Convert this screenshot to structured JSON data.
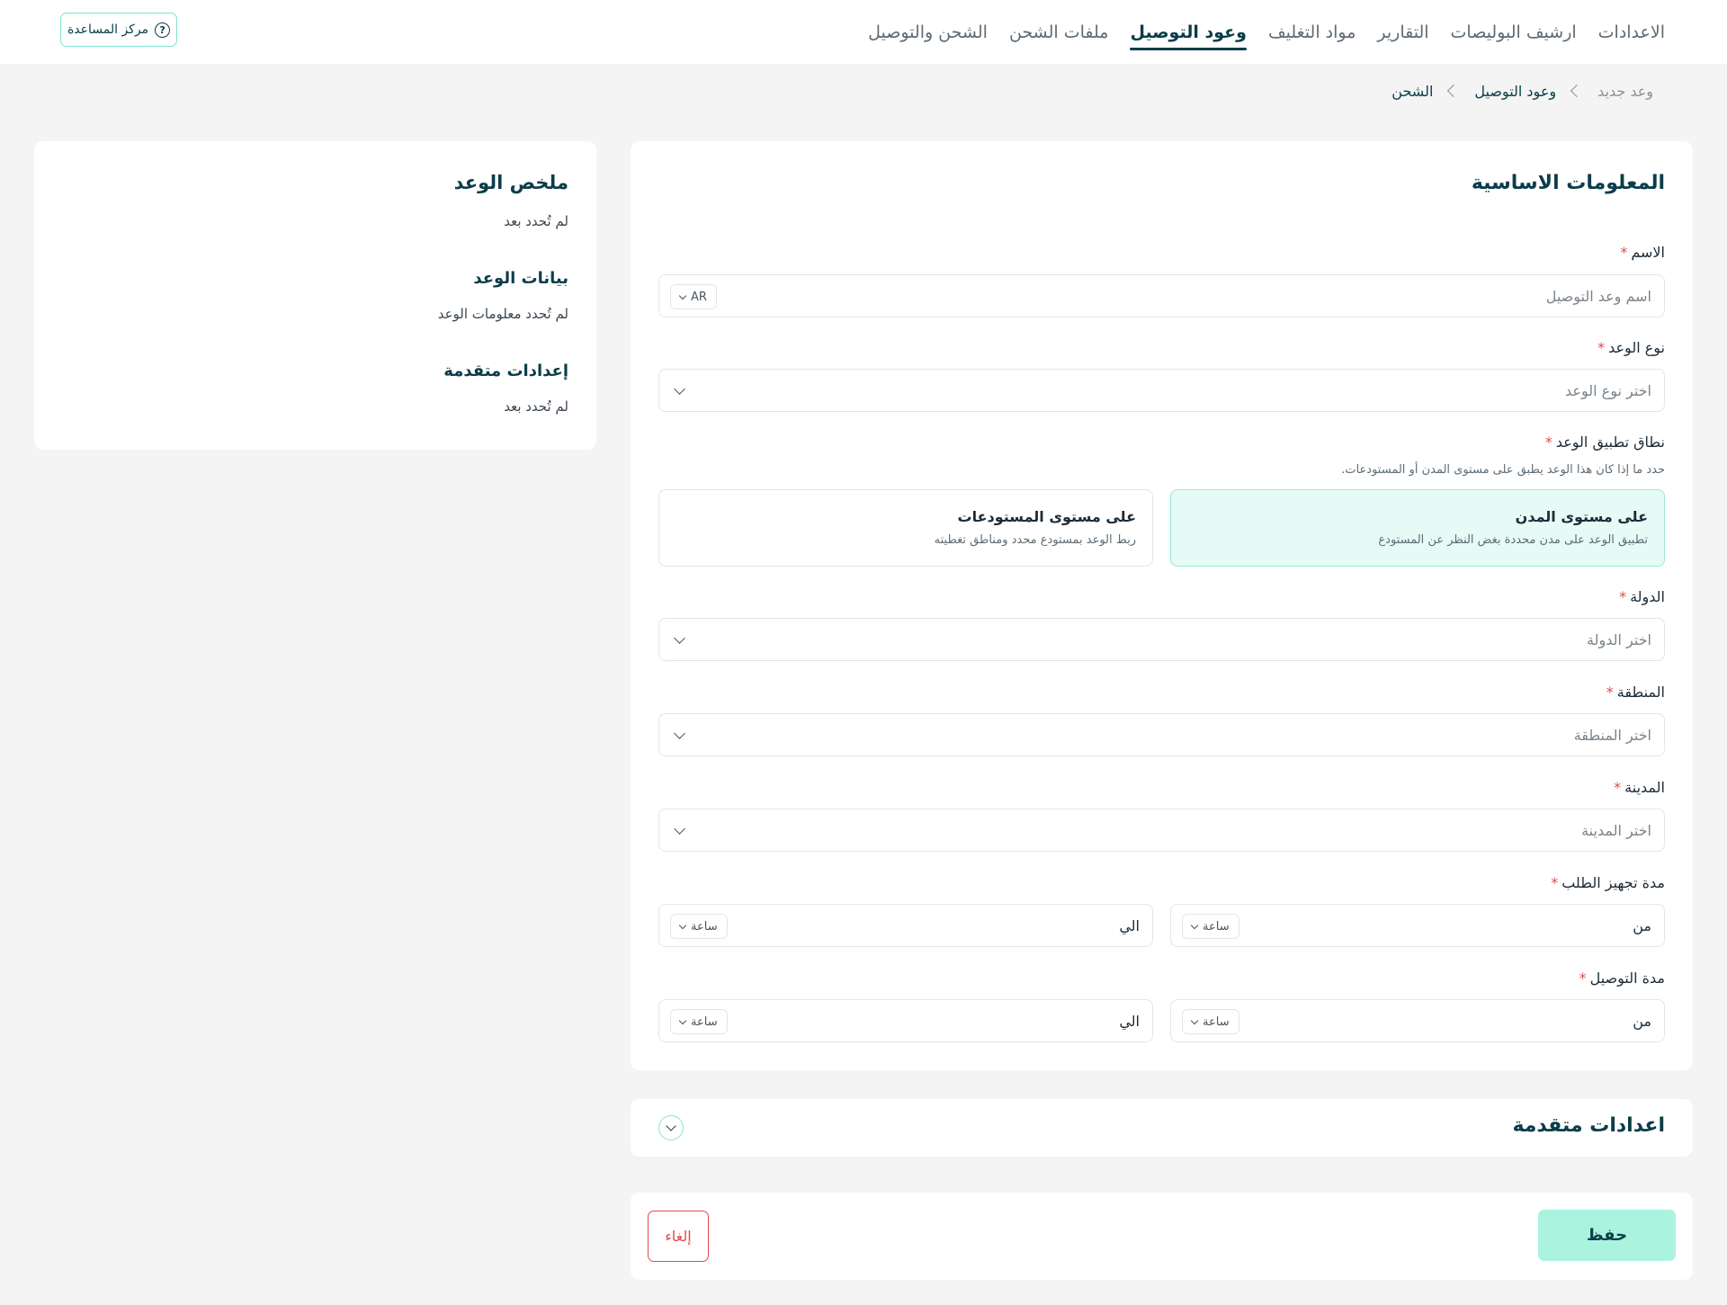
{
  "header": {
    "nav": [
      {
        "label": "الشحن والتوصيل",
        "active": false
      },
      {
        "label": "ملفات الشحن",
        "active": false
      },
      {
        "label": "وعود التوصيل",
        "active": true
      },
      {
        "label": "مواد التغليف",
        "active": false
      },
      {
        "label": "التقارير",
        "active": false
      },
      {
        "label": "ارشيف البوليصات",
        "active": false
      },
      {
        "label": "الاعدادات",
        "active": false
      }
    ],
    "help_label": "مركز المساعدة",
    "help_icon": "question-circle-icon"
  },
  "breadcrumb": {
    "items": [
      "الشحن",
      "وعود التوصيل"
    ],
    "current": "وعد جديد"
  },
  "summary": {
    "title": "ملخص الوعد",
    "title_value": "لم تُحدد بعد",
    "data_title": "بيانات الوعد",
    "data_value": "لم تُحدد معلومات الوعد",
    "advanced_title": "إعدادات متقدمة",
    "advanced_value": "لم تُحدد بعد"
  },
  "form": {
    "section_title": "المعلومات الاساسية",
    "name": {
      "label": "الاسم",
      "placeholder": "اسم وعد التوصيل",
      "lang": "AR"
    },
    "type": {
      "label": "نوع الوعد",
      "placeholder": "اختر نوع الوعد"
    },
    "scope": {
      "label": "نطاق تطبيق الوعد",
      "help": "حدد ما إذا كان هذا الوعد يطبق على مستوى المدن أو المستودعات.",
      "options": [
        {
          "title": "على مستوى المدن",
          "desc": "تطبيق الوعد على مدن محددة بغض النظر عن المستودع",
          "selected": true
        },
        {
          "title": "على مستوى المستودعات",
          "desc": "ربط الوعد بمستودع محدد ومناطق تغطيته",
          "selected": false
        }
      ]
    },
    "country": {
      "label": "الدولة",
      "placeholder": "اختر الدولة"
    },
    "region": {
      "label": "المنطقة",
      "placeholder": "اختر المنطقة"
    },
    "city": {
      "label": "المدينة",
      "placeholder": "اختر المدينة"
    },
    "prep": {
      "label": "مدة تجهيز الطلب",
      "from": "من",
      "to": "الي",
      "unit": "ساعة"
    },
    "delivery": {
      "label": "مدة التوصيل",
      "from": "من",
      "to": "الي",
      "unit": "ساعة"
    },
    "required_mark": "*"
  },
  "advanced": {
    "title": "اعدادات متقدمة"
  },
  "actions": {
    "save": "حفظ",
    "cancel": "إلغاء"
  },
  "colors": {
    "primary": "#0b3d4a",
    "accent": "#a9f3df",
    "danger": "#e5484d",
    "selected_bg": "#e6fbf5"
  }
}
